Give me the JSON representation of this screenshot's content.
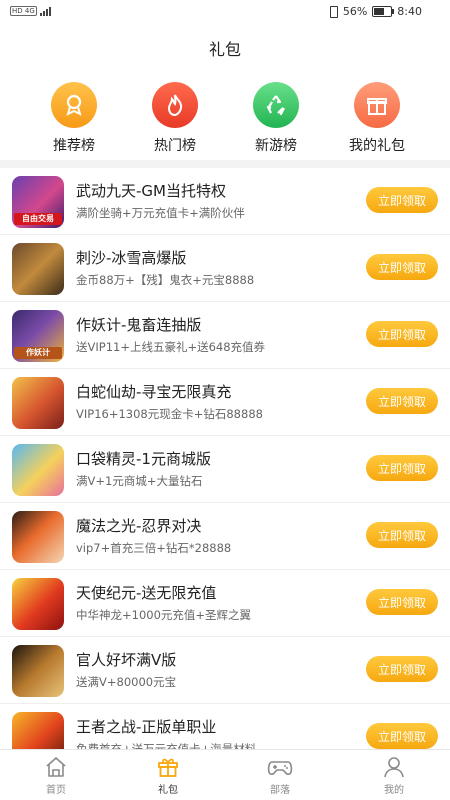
{
  "status_bar": {
    "network_left": "HD 4G",
    "battery_percent": "56%",
    "time": "8:40"
  },
  "page_title": "礼包",
  "categories": [
    {
      "label": "推荐榜",
      "icon": "medal-icon",
      "color": "#f79a17"
    },
    {
      "label": "热门榜",
      "icon": "flame-icon",
      "color": "#e83a27"
    },
    {
      "label": "新游榜",
      "icon": "recycle-icon",
      "color": "#22b452"
    },
    {
      "label": "我的礼包",
      "icon": "gift-icon",
      "color": "#f66a44"
    }
  ],
  "claim_label": "立即领取",
  "games": [
    {
      "name": "武动九天-GM当托特权",
      "desc": "满阶坐骑+万元充值卡+满阶伙伴",
      "thumb_text": "自由交易"
    },
    {
      "name": "刺沙-冰雪高爆版",
      "desc": "金币88万+【残】鬼衣+元宝8888",
      "thumb_text": ""
    },
    {
      "name": "作妖计-鬼畜连抽版",
      "desc": "送VIP11+上线五豪礼+送648充值券",
      "thumb_text": "作妖计"
    },
    {
      "name": "白蛇仙劫-寻宝无限真充",
      "desc": "VIP16+1308元现金卡+钻石88888",
      "thumb_text": ""
    },
    {
      "name": "口袋精灵-1元商城版",
      "desc": "满V+1元商城+大量钻石",
      "thumb_text": ""
    },
    {
      "name": "魔法之光-忍界对决",
      "desc": "vip7+首充三倍+钻石*28888",
      "thumb_text": ""
    },
    {
      "name": "天使纪元-送无限充值",
      "desc": "中华神龙+1000元充值+圣辉之翼",
      "thumb_text": ""
    },
    {
      "name": "官人好坏满V版",
      "desc": "送满V+80000元宝",
      "thumb_text": ""
    },
    {
      "name": "王者之战-正版单职业",
      "desc": "免费首充+送万元充值卡+海量材料",
      "thumb_text": ""
    }
  ],
  "tabs": [
    {
      "label": "首页",
      "icon": "home-icon",
      "active": false
    },
    {
      "label": "礼包",
      "icon": "gift-icon",
      "active": true
    },
    {
      "label": "部落",
      "icon": "gamepad-icon",
      "active": false
    },
    {
      "label": "我的",
      "icon": "user-icon",
      "active": false
    }
  ],
  "colors": {
    "accent": "#f6a80f",
    "active_tab_icon": "#f6a80f"
  }
}
